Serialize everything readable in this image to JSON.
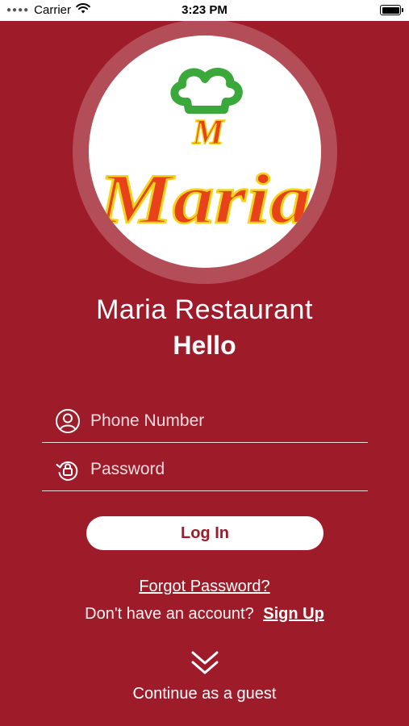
{
  "status_bar": {
    "carrier": "Carrier",
    "time": "3:23 PM",
    "icons": [
      "signal-dots-icon",
      "wifi-icon",
      "battery-icon"
    ]
  },
  "logo": {
    "monogram": "M",
    "wordmark": "Maria",
    "icons": [
      "chef-hat-icon"
    ],
    "colors": {
      "hat": "#3aa83a",
      "letters": "#e8421a",
      "letter_outline": "#f2d41c"
    }
  },
  "header": {
    "restaurant_name": "Maria Restaurant",
    "greeting": "Hello"
  },
  "form": {
    "phone": {
      "placeholder": "Phone Number",
      "value": "",
      "icon": "user-icon"
    },
    "password": {
      "placeholder": "Password",
      "value": "",
      "icon": "reset-lock-icon"
    },
    "login_label": "Log In"
  },
  "links": {
    "forgot_password": "Forgot Password?",
    "no_account_text": "Don't have an account?",
    "sign_up": "Sign Up"
  },
  "guest": {
    "label": "Continue as a guest",
    "icon": "double-chevron-down-icon"
  },
  "colors": {
    "background": "#9e1b2a",
    "button_bg": "#ffffff",
    "button_text": "#9e1b2a"
  }
}
